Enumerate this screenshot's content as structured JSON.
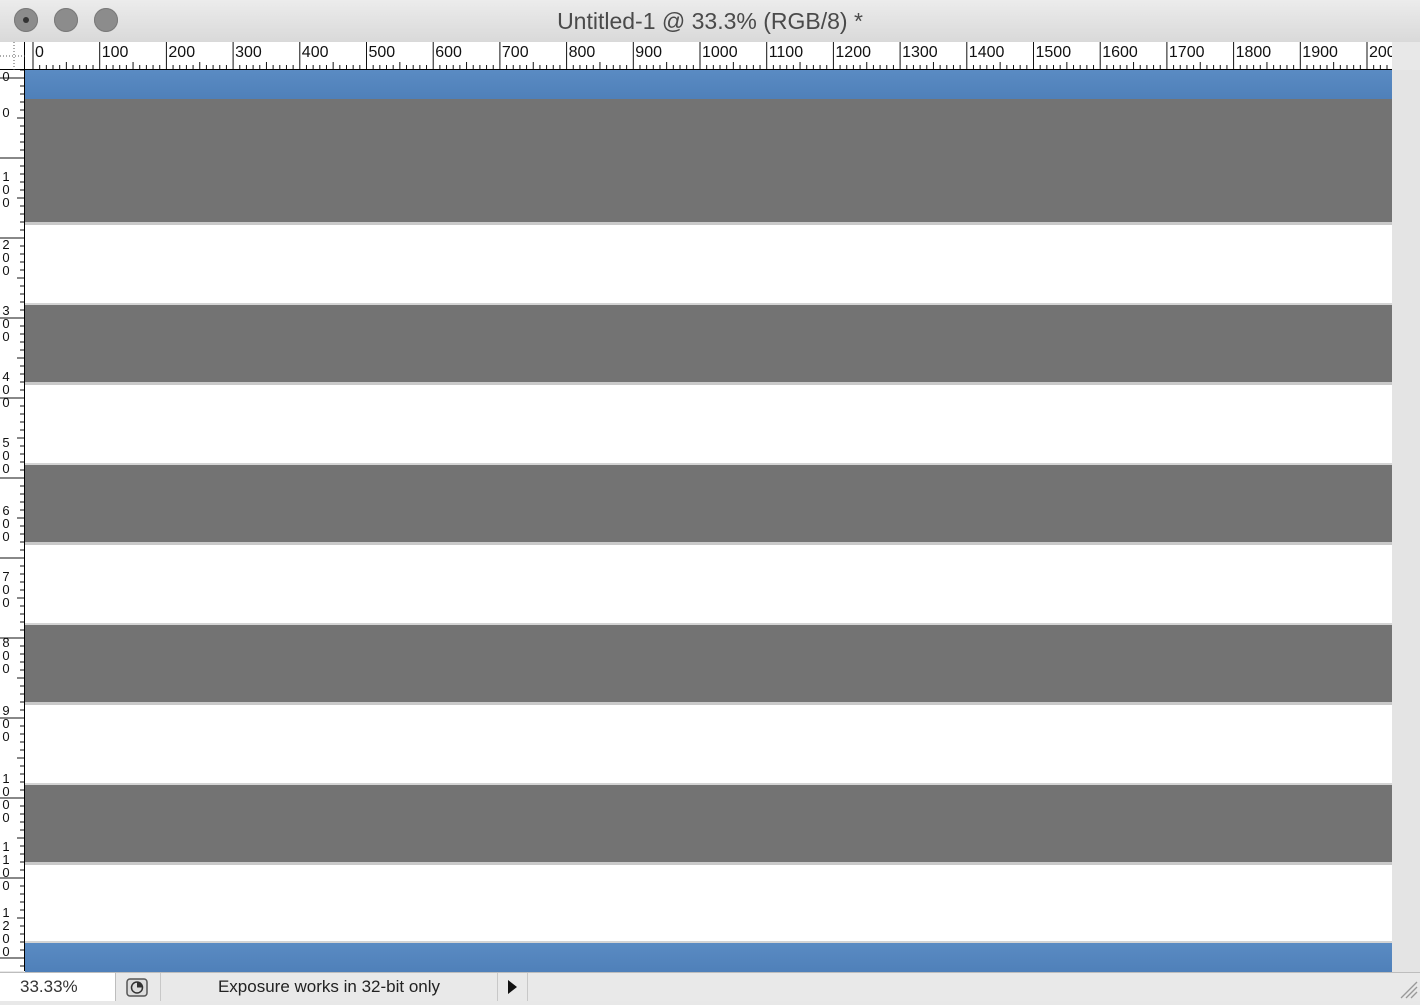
{
  "window": {
    "title": "Untitled-1 @ 33.3% (RGB/8) *"
  },
  "rulers": {
    "horizontal_labels": [
      "0",
      "100",
      "200",
      "300",
      "400",
      "500",
      "600",
      "700",
      "800",
      "900",
      "1000",
      "1100",
      "1200",
      "1300",
      "1400",
      "1500",
      "1600",
      "1700",
      "1800",
      "1900",
      "200"
    ],
    "vertical_labels": [
      "0",
      "0",
      "1\n0\n0",
      "2\n0\n0",
      "3\n0\n0",
      "4\n0\n0",
      "5\n0\n0",
      "6\n0\n0",
      "7\n0\n0",
      "8\n0\n0",
      "9\n0\n0",
      "1\n0\n0\n0",
      "1\n1\n0\n0",
      "1\n2\n0\n0"
    ]
  },
  "canvas": {
    "band_colors": {
      "blue": "#5a8bc3",
      "gray": "#737373",
      "white": "#ffffff"
    }
  },
  "status_bar": {
    "zoom": "33.33%",
    "message": "Exposure works in 32-bit only"
  },
  "icons": {
    "window_buttons": [
      "close-icon",
      "minimize-icon",
      "zoom-icon"
    ],
    "status": [
      "pie-clock-icon",
      "play-arrow-icon",
      "resize-grip-icon"
    ]
  }
}
